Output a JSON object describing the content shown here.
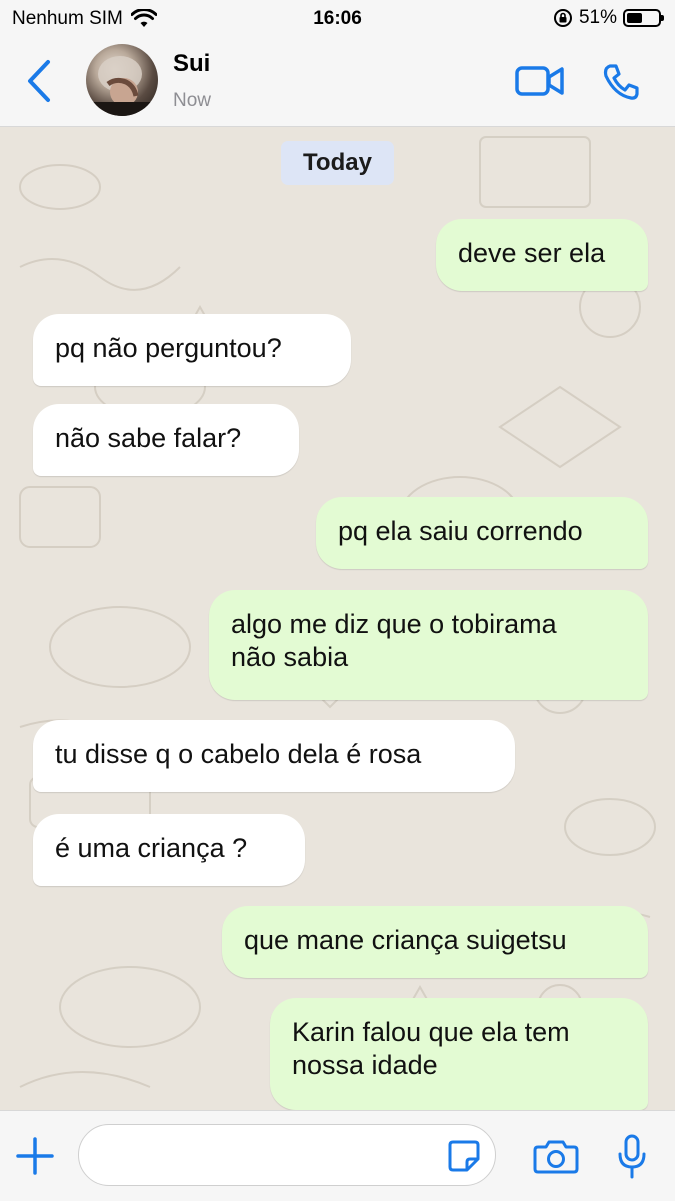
{
  "status_bar": {
    "carrier": "Nenhum SIM",
    "time": "16:06",
    "battery_percent": "51%",
    "battery_level": 0.51
  },
  "header": {
    "contact_name": "Sui",
    "contact_status": "Now",
    "accent_color": "#1a7ae8"
  },
  "chat": {
    "date_label": "Today",
    "messages": [
      {
        "direction": "outgoing",
        "text": "deve ser ela"
      },
      {
        "direction": "incoming",
        "text": "pq não perguntou?"
      },
      {
        "direction": "incoming",
        "text": "não sabe falar?"
      },
      {
        "direction": "outgoing",
        "text": "pq ela saiu correndo"
      },
      {
        "direction": "outgoing",
        "lines": [
          "algo me diz que o tobirama",
          "não sabia"
        ]
      },
      {
        "direction": "incoming",
        "text": "tu disse q o cabelo dela é rosa"
      },
      {
        "direction": "incoming",
        "text": "é uma criança ?"
      },
      {
        "direction": "outgoing",
        "text": "que mane criança suigetsu"
      },
      {
        "direction": "outgoing",
        "lines": [
          "Karin falou que ela tem",
          "nossa idade"
        ]
      }
    ]
  },
  "input_bar": {
    "message_value": "",
    "icons": [
      "plus-icon",
      "sticker-icon",
      "camera-icon",
      "microphone-icon"
    ]
  },
  "colors": {
    "incoming_bubble": "#ffffff",
    "outgoing_bubble": "#e3fbd3",
    "chat_background": "#e9e4dc",
    "date_chip": "#dde5f6"
  }
}
